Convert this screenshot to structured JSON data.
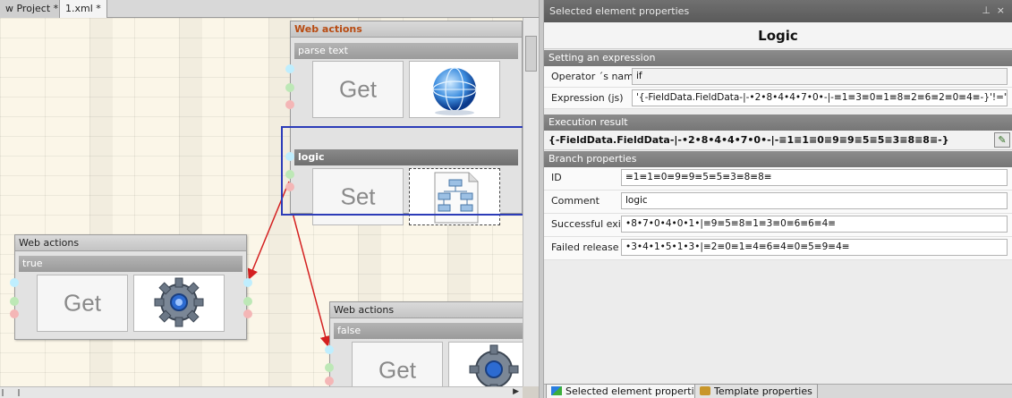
{
  "doc_tabs": [
    "w Project *",
    "1.xml *"
  ],
  "blocks": {
    "web_actions_top": {
      "header": "Web actions",
      "parse_text": {
        "title": "parse text",
        "tile_label": "Get",
        "icon": "globe-icon"
      },
      "logic": {
        "title": "logic",
        "tile_label": "Set",
        "icon": "flowchart-icon"
      }
    },
    "web_actions_true": {
      "header": "Web actions",
      "sub_title": "true",
      "tile_label": "Get",
      "icon": "gear-icon"
    },
    "web_actions_false": {
      "header": "Web actions",
      "sub_title": "false",
      "tile_label": "Get",
      "icon": "gear-icon"
    }
  },
  "panel": {
    "title": "Selected element properties",
    "pin": "⊥",
    "close": "×",
    "heading": "Logic",
    "setting_expression": {
      "section": "Setting an expression",
      "operator_label": "Operator ´s name",
      "operator_value": "if",
      "expression_label": "Expression (js)",
      "expression_value": "'{-FieldData.FieldData-|-•2•8•4•4•7•0•-|-≡1≡3≡0≡1≡8≡2≡6≡2≡0≡4≡-}'!=\""
    },
    "execution_result": {
      "section": "Execution result",
      "value": "{-FieldData.FieldData-|-•2•8•4•4•7•0•-|-≡1≡1≡0≡9≡9≡5≡5≡3≡8≡8≡-}"
    },
    "branch": {
      "section": "Branch properties",
      "id_label": "ID",
      "id_value": "≡1≡1≡0≡9≡9≡5≡5≡3≡8≡8≡",
      "comment_label": "Comment",
      "comment_value": "logic",
      "success_label": "Successful exit",
      "success_value": "•8•7•0•4•0•1•|≡9≡5≡8≡1≡3≡0≡6≡6≡4≡",
      "failed_label": "Failed release",
      "failed_value": "•3•4•1•5•1•3•|≡2≡0≡1≡4≡6≡4≡0≡5≡9≡4≡"
    },
    "bottom_tabs": [
      "Selected element properties",
      "Template properties"
    ]
  }
}
